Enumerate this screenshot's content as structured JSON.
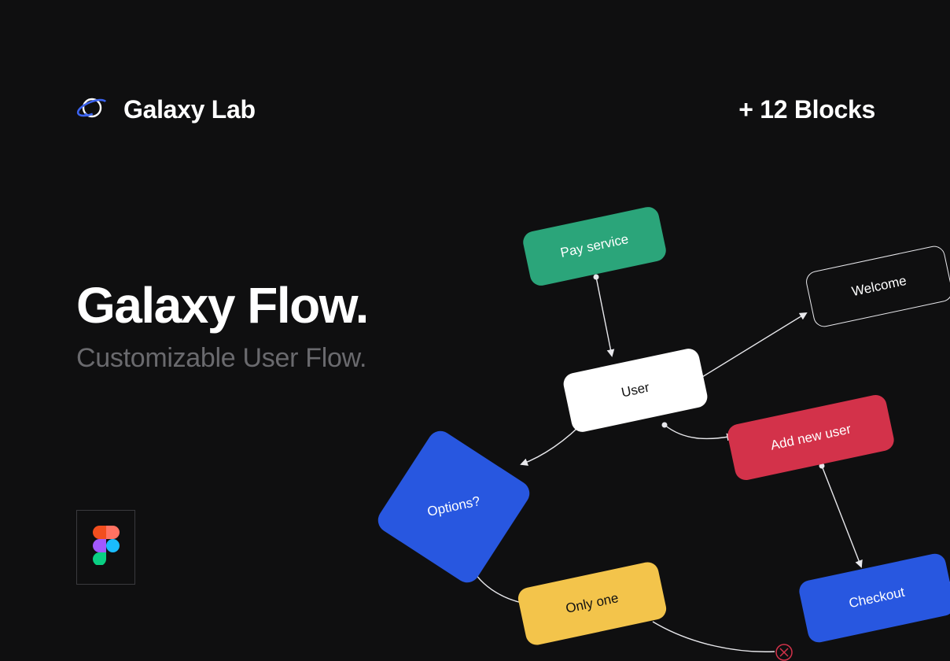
{
  "brand": {
    "name": "Galaxy Lab"
  },
  "badge": {
    "blocks": "+ 12 Blocks"
  },
  "hero": {
    "title": "Galaxy Flow.",
    "subtitle": "Customizable User Flow."
  },
  "flow": {
    "pay_service": "Pay service",
    "welcome": "Welcome",
    "user": "User",
    "add_new_user": "Add new user",
    "options": "Options?",
    "only_one": "Only one",
    "checkout": "Checkout"
  },
  "icons": {
    "planet": "planet-icon",
    "figma": "figma-icon",
    "close": "close-circle-icon"
  }
}
